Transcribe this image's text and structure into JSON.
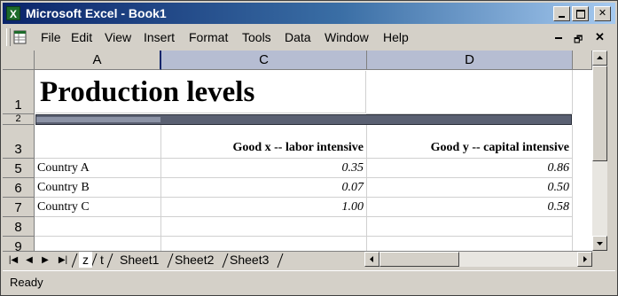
{
  "window": {
    "title": "Microsoft Excel - Book1",
    "app_icon": "excel-icon"
  },
  "menu": {
    "items": [
      "File",
      "Edit",
      "View",
      "Insert",
      "Format",
      "Tools",
      "Data",
      "Window",
      "Help"
    ]
  },
  "columns": [
    "A",
    "C",
    "D"
  ],
  "rows": [
    "1",
    "2",
    "3",
    "5",
    "6",
    "7",
    "8",
    "9"
  ],
  "cells": {
    "title": "Production levels",
    "header_c": "Good x -- labor intensive",
    "header_d": "Good y -- capital intensive",
    "data": [
      {
        "country": "Country A",
        "x": "0.35",
        "y": "0.86"
      },
      {
        "country": "Country B",
        "x": "0.07",
        "y": "0.50"
      },
      {
        "country": "Country C",
        "x": "1.00",
        "y": "0.58"
      }
    ]
  },
  "sheets": {
    "active": "z",
    "tabs": [
      "z",
      "t",
      "Sheet1",
      "Sheet2",
      "Sheet3"
    ]
  },
  "status": "Ready"
}
